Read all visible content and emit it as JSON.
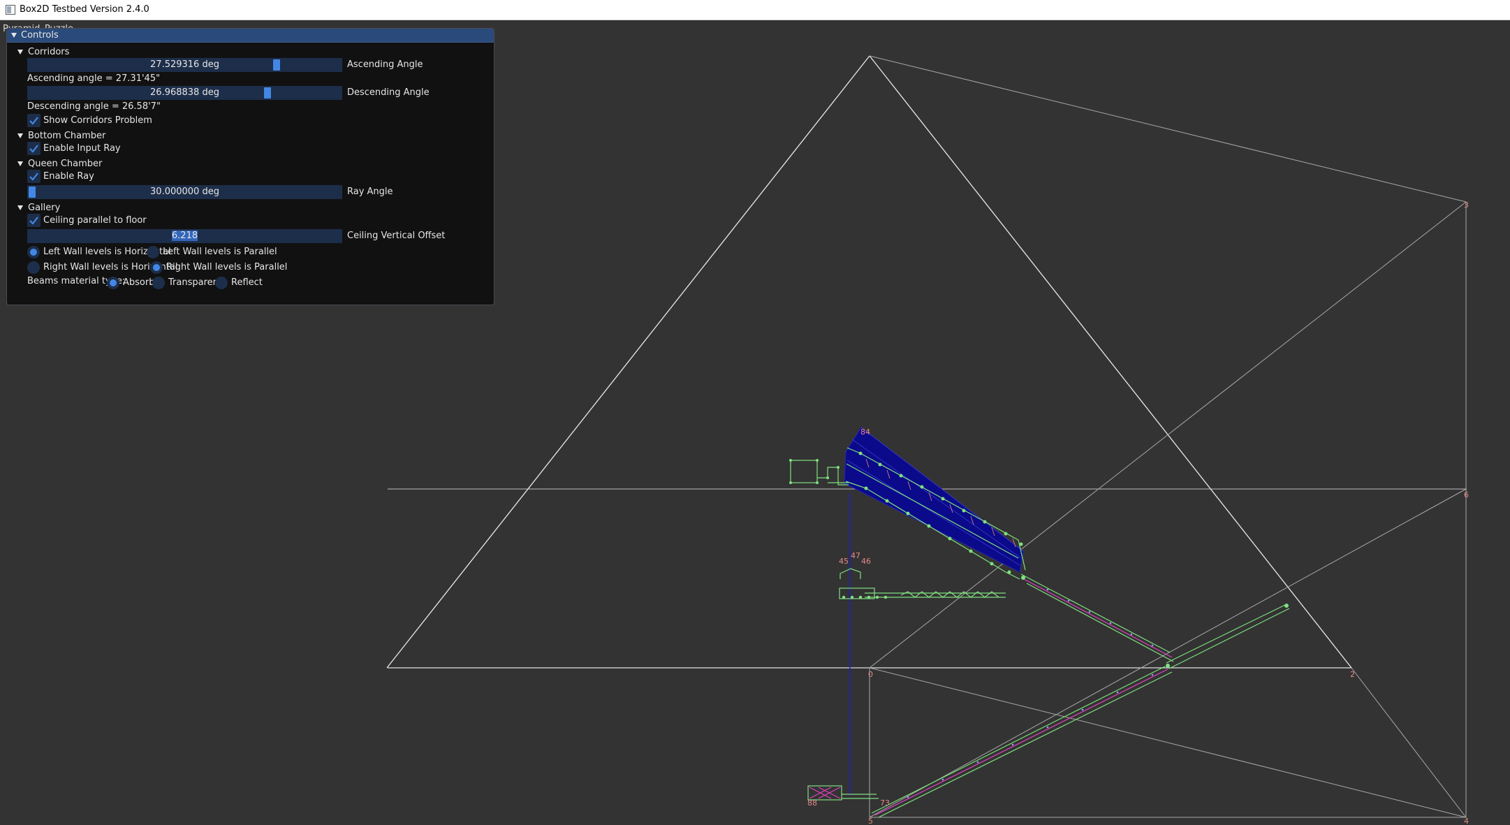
{
  "window": {
    "title": "Box2D Testbed Version 2.4.0",
    "icon": "app-window-icon"
  },
  "behind_label": "Pyramid_Puzzle",
  "panel": {
    "title": "Controls",
    "corridors": {
      "header": "Corridors",
      "ascending_slider_value": "27.529316 deg",
      "ascending_slider_label": "Ascending Angle",
      "ascending_angle_text": "Ascending angle =  27.31'45\"",
      "descending_slider_value": "26.968838 deg",
      "descending_slider_label": "Descending Angle",
      "descending_angle_text": "Descending angle =  26.58'7\"",
      "show_problem_label": "Show Corridors Problem",
      "show_problem_checked": true
    },
    "bottom_chamber": {
      "header": "Bottom Chamber",
      "enable_input_ray_label": "Enable Input Ray",
      "enable_input_ray_checked": true
    },
    "queen_chamber": {
      "header": "Queen Chamber",
      "enable_ray_label": "Enable Ray",
      "enable_ray_checked": true,
      "ray_slider_value": "30.000000 deg",
      "ray_slider_label": "Ray Angle"
    },
    "gallery": {
      "header": "Gallery",
      "ceiling_parallel_label": "Ceiling parallel to floor",
      "ceiling_parallel_checked": true,
      "ceiling_offset_value": "6.218",
      "ceiling_offset_label": "Ceiling Vertical Offset",
      "left_horizontal_label": "Left Wall levels is Horizontal",
      "left_parallel_label": "Left Wall levels is Parallel",
      "right_horizontal_label": "Right Wall levels is Horizontal",
      "right_parallel_label": "Right Wall levels is Parallel",
      "left_selected": "horizontal",
      "right_selected": "parallel"
    },
    "beams": {
      "label": "Beams material type:",
      "absorb": "Absorb",
      "transparent": "Transparent",
      "reflect": "Reflect",
      "selected": "absorb"
    }
  },
  "scene_labels": {
    "v0": "0",
    "v2": "2",
    "v3": "3",
    "v4": "4",
    "v5": "5",
    "v6": "6",
    "v84": "84",
    "v88": "88",
    "v73": "73",
    "v47": "47",
    "v46": "46",
    "v45": "45"
  },
  "colors": {
    "background": "#333333",
    "wire": "#e0e0e0",
    "green": "#80e080",
    "blue": "#1010a0",
    "magenta": "#e040c0",
    "vertex_label": "#e88a8a",
    "slider_bg": "#1d2e4a",
    "accent": "#4287e5"
  }
}
